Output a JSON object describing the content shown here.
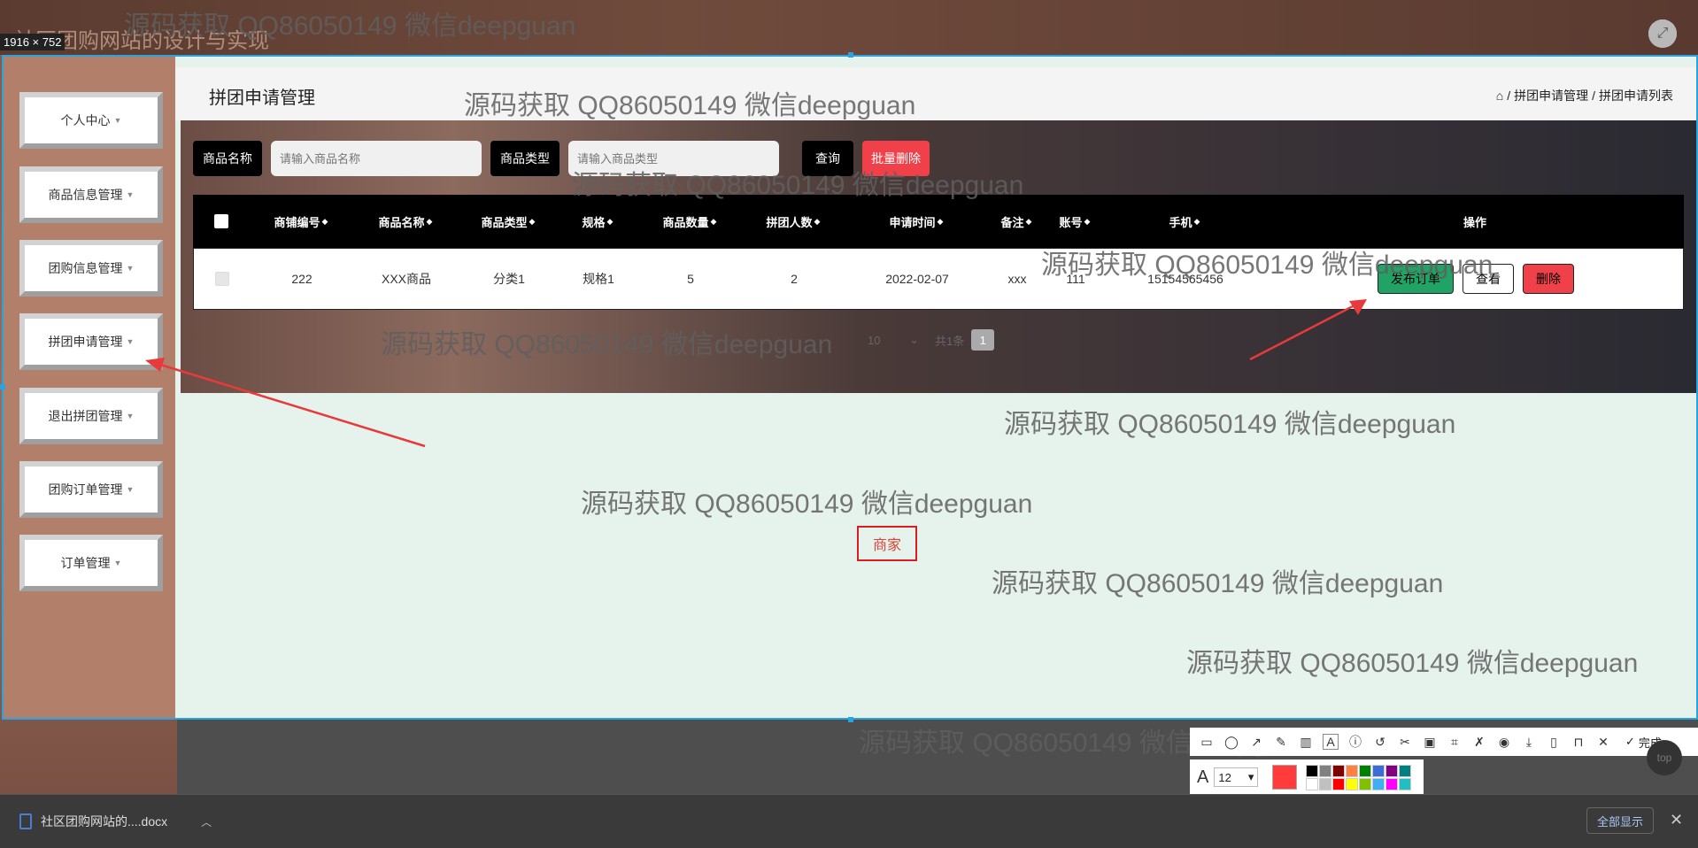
{
  "app": {
    "title": "社区团购网站的设计与实现"
  },
  "screenshot_tool": {
    "size_label": "1916 × 752"
  },
  "sidebar": {
    "items": [
      {
        "label": "个人中心"
      },
      {
        "label": "商品信息管理"
      },
      {
        "label": "团购信息管理"
      },
      {
        "label": "拼团申请管理"
      },
      {
        "label": "退出拼团管理"
      },
      {
        "label": "团购订单管理"
      },
      {
        "label": "订单管理"
      }
    ]
  },
  "page": {
    "title": "拼团申请管理",
    "breadcrumb": [
      "拼团申请管理",
      "拼团申请列表"
    ]
  },
  "search": {
    "name_label": "商品名称",
    "name_placeholder": "请输入商品名称",
    "type_label": "商品类型",
    "type_placeholder": "请输入商品类型",
    "query_button": "查询",
    "batch_delete_button": "批量删除"
  },
  "table": {
    "columns": [
      "商铺编号",
      "商品名称",
      "商品类型",
      "规格",
      "商品数量",
      "拼团人数",
      "申请时间",
      "备注",
      "账号",
      "手机",
      "操作"
    ],
    "rows": [
      {
        "shop_no": "222",
        "product_name": "XXX商品",
        "product_type": "分类1",
        "spec": "规格1",
        "quantity": "5",
        "group_size": "2",
        "apply_time": "2022-02-07",
        "remark": "xxx",
        "account": "111",
        "phone": "15154565456",
        "actions": {
          "publish": "发布订单",
          "view": "查看",
          "delete": "删除"
        }
      }
    ]
  },
  "pager": {
    "page_size": "10",
    "total_label": "共1条",
    "current_page": "1"
  },
  "annotation_text": "商家",
  "watermark": "源码获取 QQ86050149 微信deepguan",
  "annotation_toolbar": {
    "done_label": "完成",
    "font_size": "12",
    "current_color": "#ff3b3b",
    "palette": [
      "#000000",
      "#808080",
      "#800000",
      "#ff8040",
      "#008000",
      "#3c6cd8",
      "#800080",
      "#008080",
      "#ffffff",
      "#c0c0c0",
      "#ff0000",
      "#ffff00",
      "#80c000",
      "#3cb0f0",
      "#ff00ff",
      "#20c0c0"
    ]
  },
  "top_button": {
    "label": "top"
  },
  "downloads": {
    "file_name": "社区团购网站的....docx",
    "show_all": "全部显示"
  }
}
